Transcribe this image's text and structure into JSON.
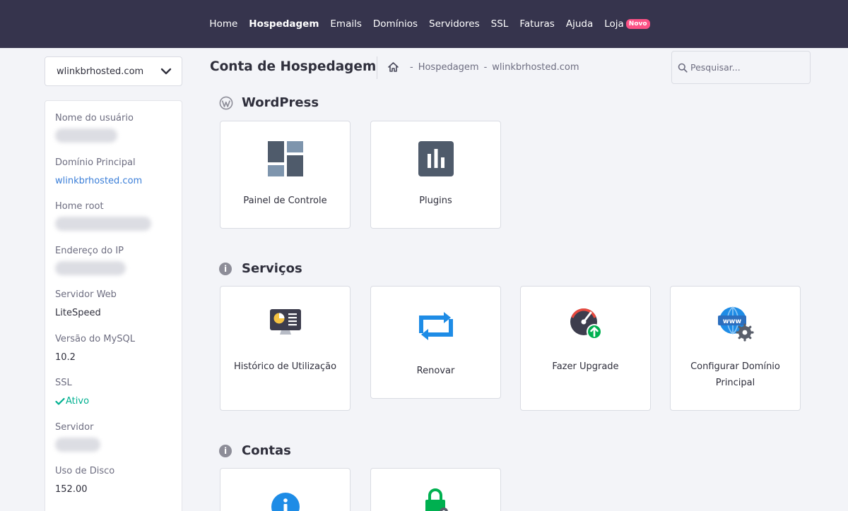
{
  "nav": {
    "items": [
      {
        "label": "Home"
      },
      {
        "label": "Hospedagem"
      },
      {
        "label": "Emails"
      },
      {
        "label": "Domínios"
      },
      {
        "label": "Servidores"
      },
      {
        "label": "SSL"
      },
      {
        "label": "Faturas"
      },
      {
        "label": "Ajuda"
      },
      {
        "label": "Loja"
      }
    ],
    "new_badge": "Novo"
  },
  "domain_select": {
    "value": "wlinkbrhosted.com"
  },
  "account_info": {
    "username_label": "Nome do usuário",
    "main_domain_label": "Domínio Principal",
    "main_domain_value": "wlinkbrhosted.com",
    "home_root_label": "Home root",
    "ip_label": "Endereço do IP",
    "web_server_label": "Servidor Web",
    "web_server_value": "LiteSpeed",
    "mysql_label": "Versão do MySQL",
    "mysql_value": "10.2",
    "ssl_label": "SSL",
    "ssl_value": "Ativo",
    "server_label": "Servidor",
    "disk_label": "Uso de Disco",
    "disk_value": "152.00"
  },
  "header": {
    "title": "Conta de Hospedagem",
    "breadcrumb": [
      "Hospedagem",
      "wlinkbrhosted.com"
    ],
    "breadcrumb_separator": "-"
  },
  "search": {
    "placeholder": "Pesquisar..."
  },
  "sections": {
    "wordpress": {
      "title": "WordPress",
      "tiles": [
        {
          "label": "Painel de Controle"
        },
        {
          "label": "Plugins"
        }
      ]
    },
    "services": {
      "title": "Serviços",
      "tiles": [
        {
          "label": "Histórico de Utilização"
        },
        {
          "label": "Renovar"
        },
        {
          "label": "Fazer Upgrade"
        },
        {
          "label": "Configurar Domínio Principal"
        }
      ]
    },
    "accounts": {
      "title": "Contas"
    }
  },
  "icons": {
    "home": "home-icon",
    "chevron": "chevron-down-icon",
    "search": "search-icon",
    "wordpress": "wordpress-icon",
    "info": "info-icon",
    "check": "check-icon"
  },
  "colors": {
    "nav_bg": "#36344d",
    "badge": "#fc5185",
    "link": "#3a7ed8",
    "success": "#00b090",
    "tile_icon": "#4f5b6b",
    "renew_blue": "#1e8ce6"
  }
}
